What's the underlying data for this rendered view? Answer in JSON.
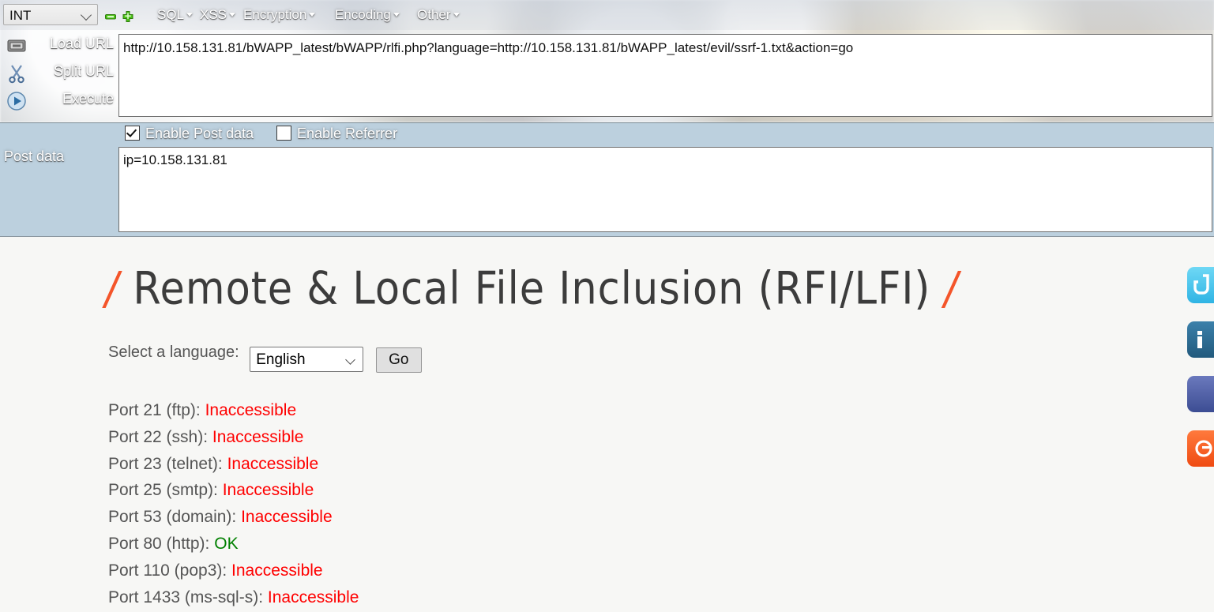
{
  "hackbar": {
    "mode_select": {
      "value": "INT",
      "icon": "chevron-down-icon"
    },
    "zoom_out_label": "−",
    "zoom_in_label": "+",
    "menus": [
      {
        "label": "SQL"
      },
      {
        "label": "XSS"
      },
      {
        "label": "Encryption"
      },
      {
        "label": "Encoding"
      },
      {
        "label": "Other"
      }
    ],
    "actions": [
      {
        "label": "Load URL",
        "icon": "load-url-icon"
      },
      {
        "label": "Split URL",
        "icon": "split-url-icon"
      },
      {
        "label": "Execute",
        "icon": "execute-icon"
      }
    ],
    "url_value": "http://10.158.131.81/bWAPP_latest/bWAPP/rlfi.php?language=http://10.158.131.81/bWAPP_latest/evil/ssrf-1.txt&action=go",
    "enable_post_data": {
      "label": "Enable Post data",
      "checked": true
    },
    "enable_referrer": {
      "label": "Enable Referrer",
      "checked": false
    },
    "post_data_label": "Post data",
    "post_data_value": "ip=10.158.131.81"
  },
  "page": {
    "title_prefix_slash": "/",
    "title": "Remote & Local File Inclusion (RFI/LFI)",
    "title_suffix_slash": "/",
    "language_label": "Select a language:",
    "language_value": "English",
    "go_label": "Go",
    "ports": [
      {
        "label": "Port 21 (ftp):",
        "status": "Inaccessible",
        "state": "bad"
      },
      {
        "label": "Port 22 (ssh):",
        "status": "Inaccessible",
        "state": "bad"
      },
      {
        "label": "Port 23 (telnet):",
        "status": "Inaccessible",
        "state": "bad"
      },
      {
        "label": "Port 25 (smtp):",
        "status": "Inaccessible",
        "state": "bad"
      },
      {
        "label": "Port 53 (domain):",
        "status": "Inaccessible",
        "state": "bad"
      },
      {
        "label": "Port 80 (http):",
        "status": "OK",
        "state": "ok"
      },
      {
        "label": "Port 110 (pop3):",
        "status": "Inaccessible",
        "state": "bad"
      },
      {
        "label": "Port 1433 (ms-sql-s):",
        "status": "Inaccessible",
        "state": "bad"
      }
    ],
    "social": [
      {
        "name": "twitter-icon",
        "glyph": "t",
        "color": "#4bc6ef"
      },
      {
        "name": "linkedin-icon",
        "glyph": "in",
        "color": "#2c6c92"
      },
      {
        "name": "facebook-icon",
        "glyph": "f",
        "color": "#4a5fa5"
      },
      {
        "name": "google-plus-icon",
        "glyph": "g",
        "color": "#f4591f"
      }
    ]
  },
  "colors": {
    "post_band": "#bcd0de",
    "accent_orange": "#f4552a",
    "status_bad": "#ff0000",
    "status_ok": "#008000"
  }
}
